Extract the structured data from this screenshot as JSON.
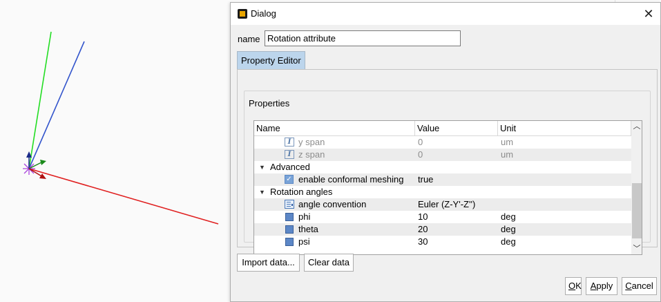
{
  "dialog": {
    "title": "Dialog",
    "close_icon": "close-icon",
    "name_label": "name",
    "name_value": "Rotation attribute",
    "tab_label": "Property Editor",
    "group_title": "Properties",
    "columns": [
      "Name",
      "Value",
      "Unit"
    ],
    "rows": [
      {
        "name": "y span",
        "value": "0",
        "unit": "um",
        "icon": "variable-icon"
      },
      {
        "name": "z span",
        "value": "0",
        "unit": "um",
        "icon": "variable-icon"
      },
      {
        "name": "Advanced",
        "value": "",
        "unit": "",
        "icon": "expand-arrow-icon"
      },
      {
        "name": "enable conformal meshing",
        "value": "true",
        "unit": "",
        "icon": "checkbox-icon"
      },
      {
        "name": "Rotation angles",
        "value": "",
        "unit": "",
        "icon": "expand-arrow-icon"
      },
      {
        "name": "angle convention",
        "value": "Euler (Z-Y'-Z'')",
        "unit": "",
        "icon": "list-icon"
      },
      {
        "name": "phi",
        "value": "10",
        "unit": "deg",
        "icon": "number-icon"
      },
      {
        "name": "theta",
        "value": "20",
        "unit": "deg",
        "icon": "number-icon"
      },
      {
        "name": "psi",
        "value": "30",
        "unit": "deg",
        "icon": "number-icon"
      }
    ],
    "buttons": {
      "import": "Import data...",
      "clear": "Clear data",
      "ok_first": "O",
      "ok_rest": "K",
      "apply_first": "A",
      "apply_rest": "pply",
      "cancel_first": "C",
      "cancel_rest": "ancel"
    }
  },
  "axes_colors": {
    "x": "#e02020",
    "y": "#22dd22",
    "z": "#3355cc",
    "origin": "#aa44dd"
  }
}
